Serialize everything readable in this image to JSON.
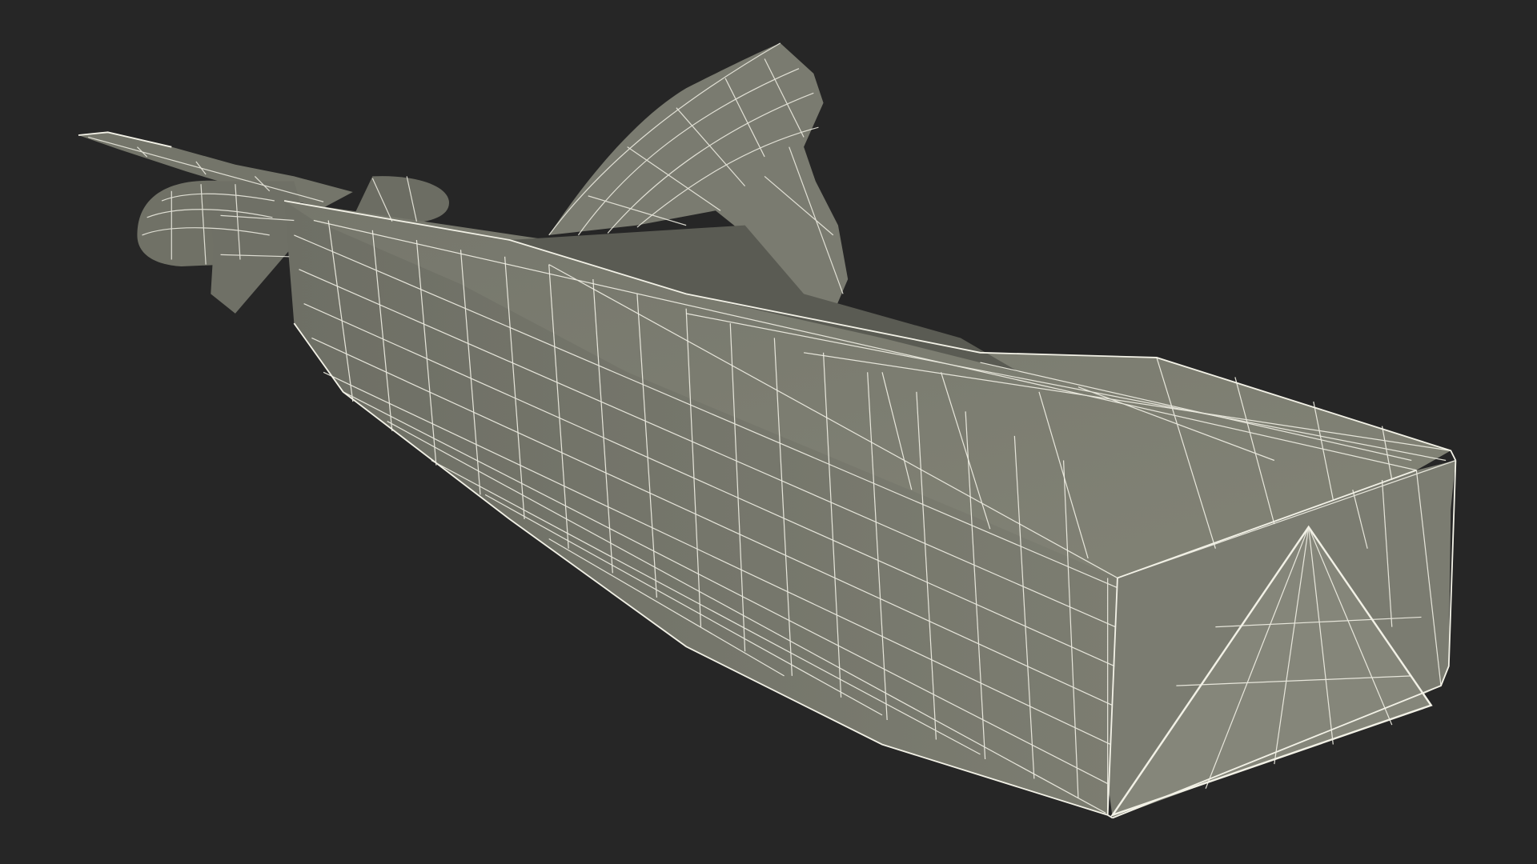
{
  "scene": {
    "subject": "wireframe-render-of-wrapped-package",
    "colors": {
      "background": "#262626",
      "surface_light": "#7f8074",
      "surface_mid": "#74756a",
      "surface_dark": "#5c5d54",
      "surface_shadow": "#45463f",
      "wire": "#f2f1e6"
    }
  }
}
